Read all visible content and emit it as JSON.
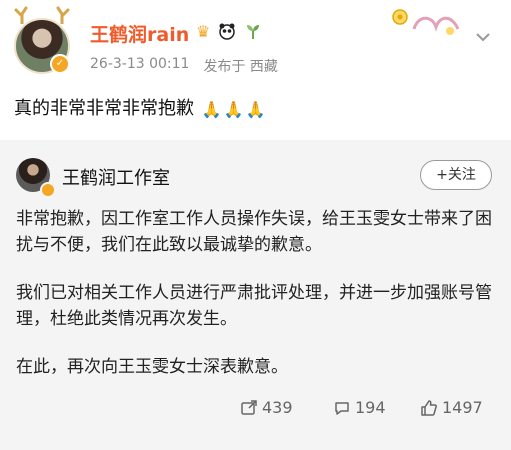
{
  "post": {
    "username": "王鹤润rain",
    "timestamp": "26-3-13 00:11",
    "location": "发布于 西藏",
    "text": "真的非常非常非常抱歉"
  },
  "repost": {
    "author": "王鹤润工作室",
    "follow_label": "+关注",
    "paragraphs": [
      "非常抱歉，因工作室工作人员操作失误，给王玉雯女士带来了困扰与不便，我们在此致以最诚挚的歉意。",
      "我们已对相关工作人员进行严肃批评处理，并进一步加强账号管理，杜绝此类情况再次发生。",
      "在此，再次向王玉雯女士深表歉意。"
    ]
  },
  "actions": {
    "repost_count": "439",
    "comment_count": "194",
    "like_count": "1497"
  },
  "icons": {
    "vip": "vip-crown-icon",
    "panda": "panda-icon",
    "sprout": "sprout-icon",
    "more": "chevron-down-icon",
    "repost": "repost-icon",
    "comment": "comment-icon",
    "like": "like-icon"
  },
  "colors": {
    "username": "#f05b2c",
    "meta": "#8a8a8a",
    "card_bg": "#f4f4f4"
  }
}
